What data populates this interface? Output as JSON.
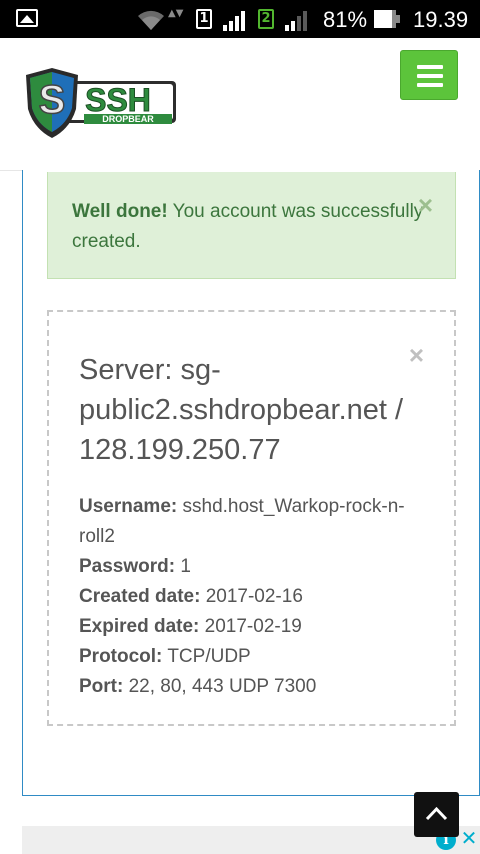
{
  "status_bar": {
    "battery_percent": "81%",
    "time": "19.39",
    "sim1_label": "1",
    "sim2_label": "2",
    "data_arrows": "▲▼"
  },
  "header": {
    "logo_text": "SSH",
    "logo_subtext": "DROPBEAR",
    "menu_icon": "hamburger-icon",
    "brand_color": "#5cc43b"
  },
  "alert": {
    "strong": "Well done!",
    "message": " You account was successfully created.",
    "close": "×"
  },
  "account": {
    "close": "×",
    "server_title": "Server: sg-public2.sshdropbear.net / 128.199.250.77",
    "details": [
      {
        "label": "Username:",
        "value": "sshd.host_Warkop-rock-n-roll2"
      },
      {
        "label": "Password:",
        "value": "1"
      },
      {
        "label": "Created date:",
        "value": "2017-02-16"
      },
      {
        "label": "Expired date:",
        "value": "2017-02-19"
      },
      {
        "label": "Protocol:",
        "value": "TCP/UDP"
      },
      {
        "label": "Port:",
        "value": "22, 80, 443 UDP 7300"
      }
    ]
  },
  "ad": {
    "info": "i",
    "close": "✕"
  }
}
